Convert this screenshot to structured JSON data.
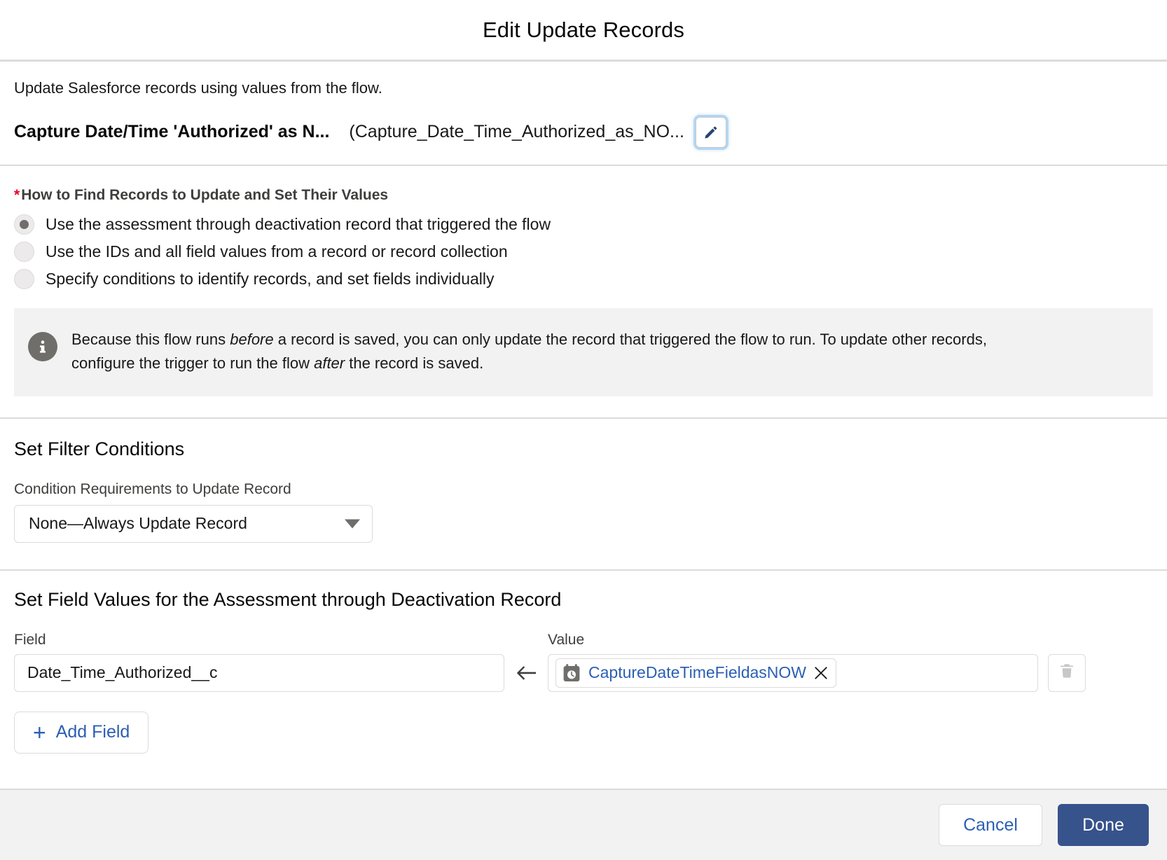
{
  "header": {
    "title": "Edit Update Records"
  },
  "intro": {
    "description": "Update Salesforce records using values from the flow.",
    "element_label": "Capture Date/Time 'Authorized' as N...",
    "element_api_name": "(Capture_Date_Time_Authorized_as_NO...",
    "edit_icon": "pencil-icon"
  },
  "find_records": {
    "group_label": "How to Find Records to Update and Set Their Values",
    "required_marker": "*",
    "options": [
      {
        "label": "Use the assessment through deactivation record that triggered the flow",
        "selected": true
      },
      {
        "label": "Use the IDs and all field values from a record or record collection",
        "selected": false
      },
      {
        "label": "Specify conditions to identify records, and set fields individually",
        "selected": false
      }
    ]
  },
  "info_callout": {
    "icon": "info-icon",
    "text_part_1": "Because this flow runs ",
    "emphasis_1": "before",
    "text_part_2": " a record is saved, you can only update the record that triggered the flow to run. To update other records, configure the trigger to run the flow ",
    "emphasis_2": "after",
    "text_part_3": " the record is saved."
  },
  "filter_conditions": {
    "heading": "Set Filter Conditions",
    "condition_label": "Condition Requirements to Update Record",
    "condition_value": "None—Always Update Record",
    "caret_icon": "chevron-down-icon",
    "options": [
      "None—Always Update Record"
    ]
  },
  "field_values": {
    "heading": "Set Field Values for the Assessment through Deactivation Record",
    "column_field": "Field",
    "column_value": "Value",
    "arrow_icon": "arrow-left-icon",
    "rows": [
      {
        "field": "Date_Time_Authorized__c",
        "value_pill_icon": "date-time-icon",
        "value_pill_text": "CaptureDateTimeFieldasNOW",
        "value_pill_remove_icon": "close-icon",
        "delete_icon": "trash-icon"
      }
    ],
    "add_field_label": "Add Field",
    "add_field_icon": "plus-icon"
  },
  "footer": {
    "cancel_label": "Cancel",
    "done_label": "Done"
  },
  "colors": {
    "brand_blue": "#2b5fb3",
    "done_button": "#36538c",
    "required_red": "#ea001e",
    "info_gray": "#706e6b",
    "border_gray": "#dddbda",
    "callout_bg": "#f3f2f2"
  }
}
